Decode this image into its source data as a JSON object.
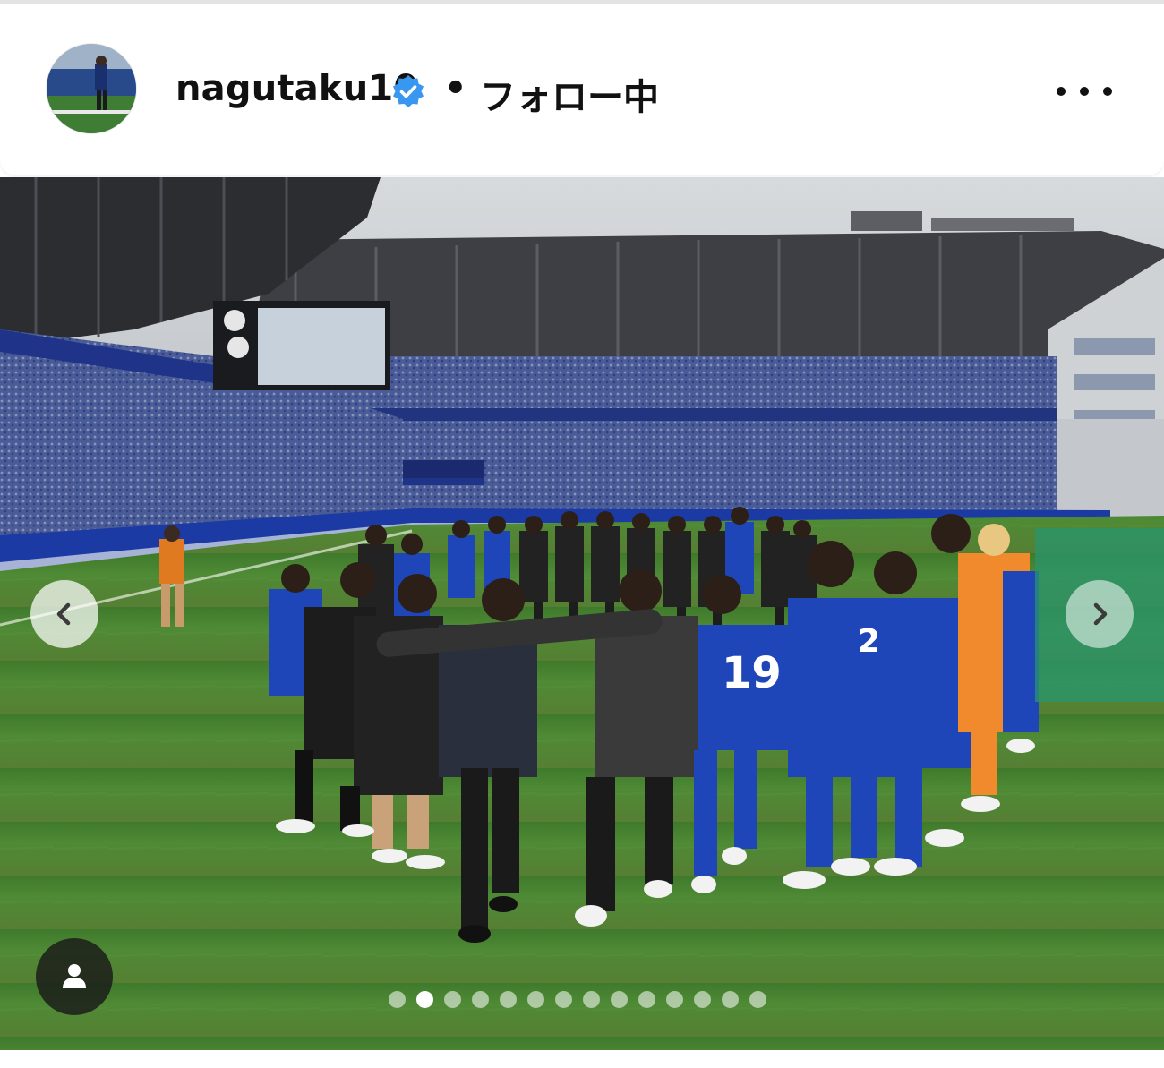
{
  "post": {
    "username": "nagutaku10",
    "separator": "•",
    "follow_status": "フォロー中",
    "more_icon": "more-horizontal-icon",
    "verified_icon": "verified-badge-icon"
  },
  "carousel": {
    "total_slides": 14,
    "current_slide": 2,
    "prev_icon": "chevron-left-icon",
    "next_icon": "chevron-right-icon",
    "tag_icon": "user-tag-icon"
  },
  "colors": {
    "verified_blue": "#3897f0",
    "pitch_green": "#4d7a35",
    "kit_blue": "#1f46b8",
    "keeper_orange": "#f08a2c"
  }
}
